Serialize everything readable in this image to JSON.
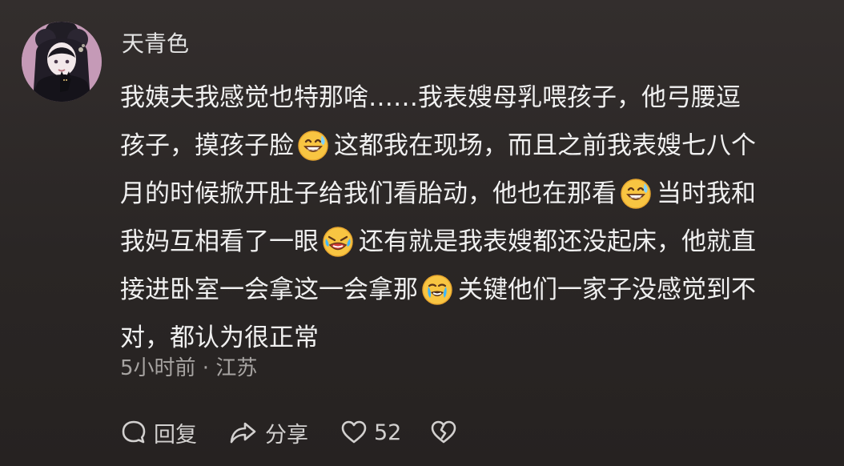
{
  "comment": {
    "username": "天青色",
    "lines": [
      [
        "我姨夫我感觉也特那啥……我表嫂母乳喂孩子，他弓腰逗"
      ],
      [
        "孩子，摸孩子脸",
        "这都我在现场，而且之前我表嫂七八个"
      ],
      [
        "月的时候掀开肚子给我们看胎动，他也在那看",
        "当时我和"
      ],
      [
        "我妈互相看了一眼",
        "还有就是我表嫂都还没起床，他就直"
      ],
      [
        "接进卧室一会拿这一会拿那",
        "关键他们一家子没感觉到不"
      ],
      [
        "对，都认为很正常"
      ]
    ],
    "emojis": [
      "grin-sweat-emoji",
      "grin-sweat-emoji",
      "rofl-emoji",
      "crying-laugh-emoji"
    ],
    "meta": "5小时前 · 江苏"
  },
  "actions": {
    "reply_label": "回复",
    "share_label": "分享",
    "like_count": "52"
  },
  "colors": {
    "background": "#2a2625",
    "text": "#f0f0f0",
    "meta": "#a7a4a2",
    "emoji": "#f8c542"
  }
}
